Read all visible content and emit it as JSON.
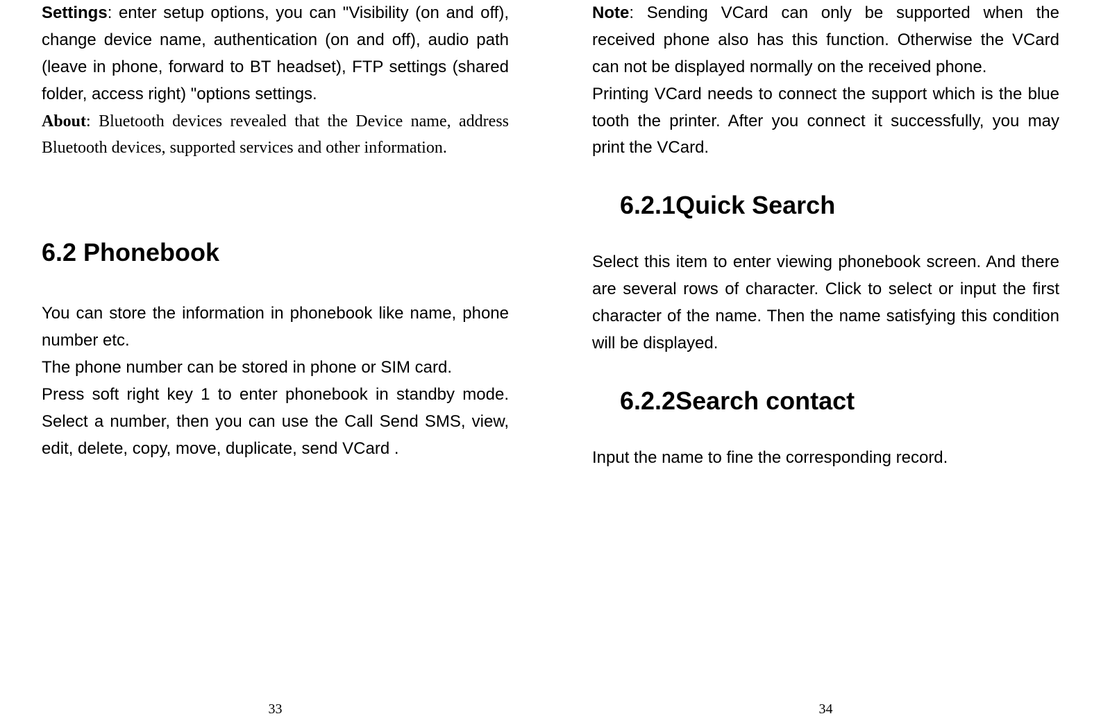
{
  "left": {
    "settings_label": "Settings",
    "settings_text": ":  enter setup options, you can \"Visibility (on and off), change device name, authentication (on and off), audio path (leave in phone, forward to BT headset), FTP settings (shared folder, access right) \"options settings.",
    "about_label": "About",
    "about_text": ": Bluetooth devices revealed that the Device name, address Bluetooth devices, supported services and other information.",
    "phonebook_heading": "6.2 Phonebook",
    "phonebook_p1": "You can store the information in phonebook like name, phone number etc.",
    "phonebook_p2": "The phone number can be stored in phone or SIM card.",
    "phonebook_p3": "Press soft right key 1 to enter phonebook in standby mode. Select a number, then you can use the Call Send SMS, view, edit, delete, copy, move, duplicate, send VCard .",
    "page_number": "33"
  },
  "right": {
    "note_label": "Note",
    "note_text": ": Sending VCard can only be supported when the received phone also has this function. Otherwise the VCard can not be displayed normally on the received phone.",
    "printing_text": "Printing VCard needs to connect the support which is the blue tooth the printer. After you connect it successfully, you may print the VCard.",
    "quick_search_heading": "6.2.1Quick Search",
    "quick_search_text": "Select this item to enter viewing phonebook screen. And there are several rows of character. Click to select or input the first character of the name. Then the name satisfying this condition will be displayed.",
    "search_contact_heading": "6.2.2Search contact",
    "search_contact_text": "Input the name to fine the corresponding record.",
    "page_number": "34"
  }
}
